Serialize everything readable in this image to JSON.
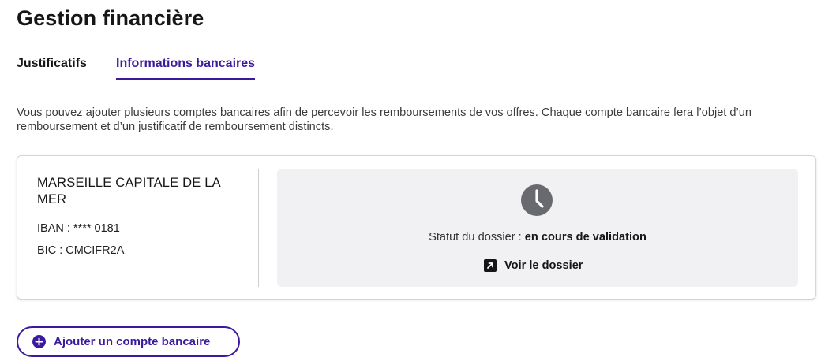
{
  "page": {
    "title": "Gestion financière"
  },
  "tabs": [
    {
      "label": "Justificatifs",
      "active": false
    },
    {
      "label": "Informations bancaires",
      "active": true
    }
  ],
  "description": "Vous pouvez ajouter plusieurs comptes bancaires afin de percevoir les remboursements de vos offres. Chaque compte bancaire fera l’objet d’un remboursement et d’un justificatif de remboursement distincts.",
  "account": {
    "name": "MARSEILLE CAPITALE DE LA MER",
    "iban": "IBAN : **** 0181",
    "bic": "BIC : CMCIFR2A",
    "status_prefix": "Statut du dossier : ",
    "status_value": "en cours de validation",
    "link_label": "Voir le dossier",
    "status_icon": "clock-icon",
    "link_icon": "external-link-icon"
  },
  "add_button": {
    "label": "Ajouter un compte bancaire",
    "icon": "plus-circle-icon"
  },
  "colors": {
    "accent": "#3c1a9e",
    "panel_bg": "#f1f1f3",
    "icon_gray": "#696a6f"
  }
}
